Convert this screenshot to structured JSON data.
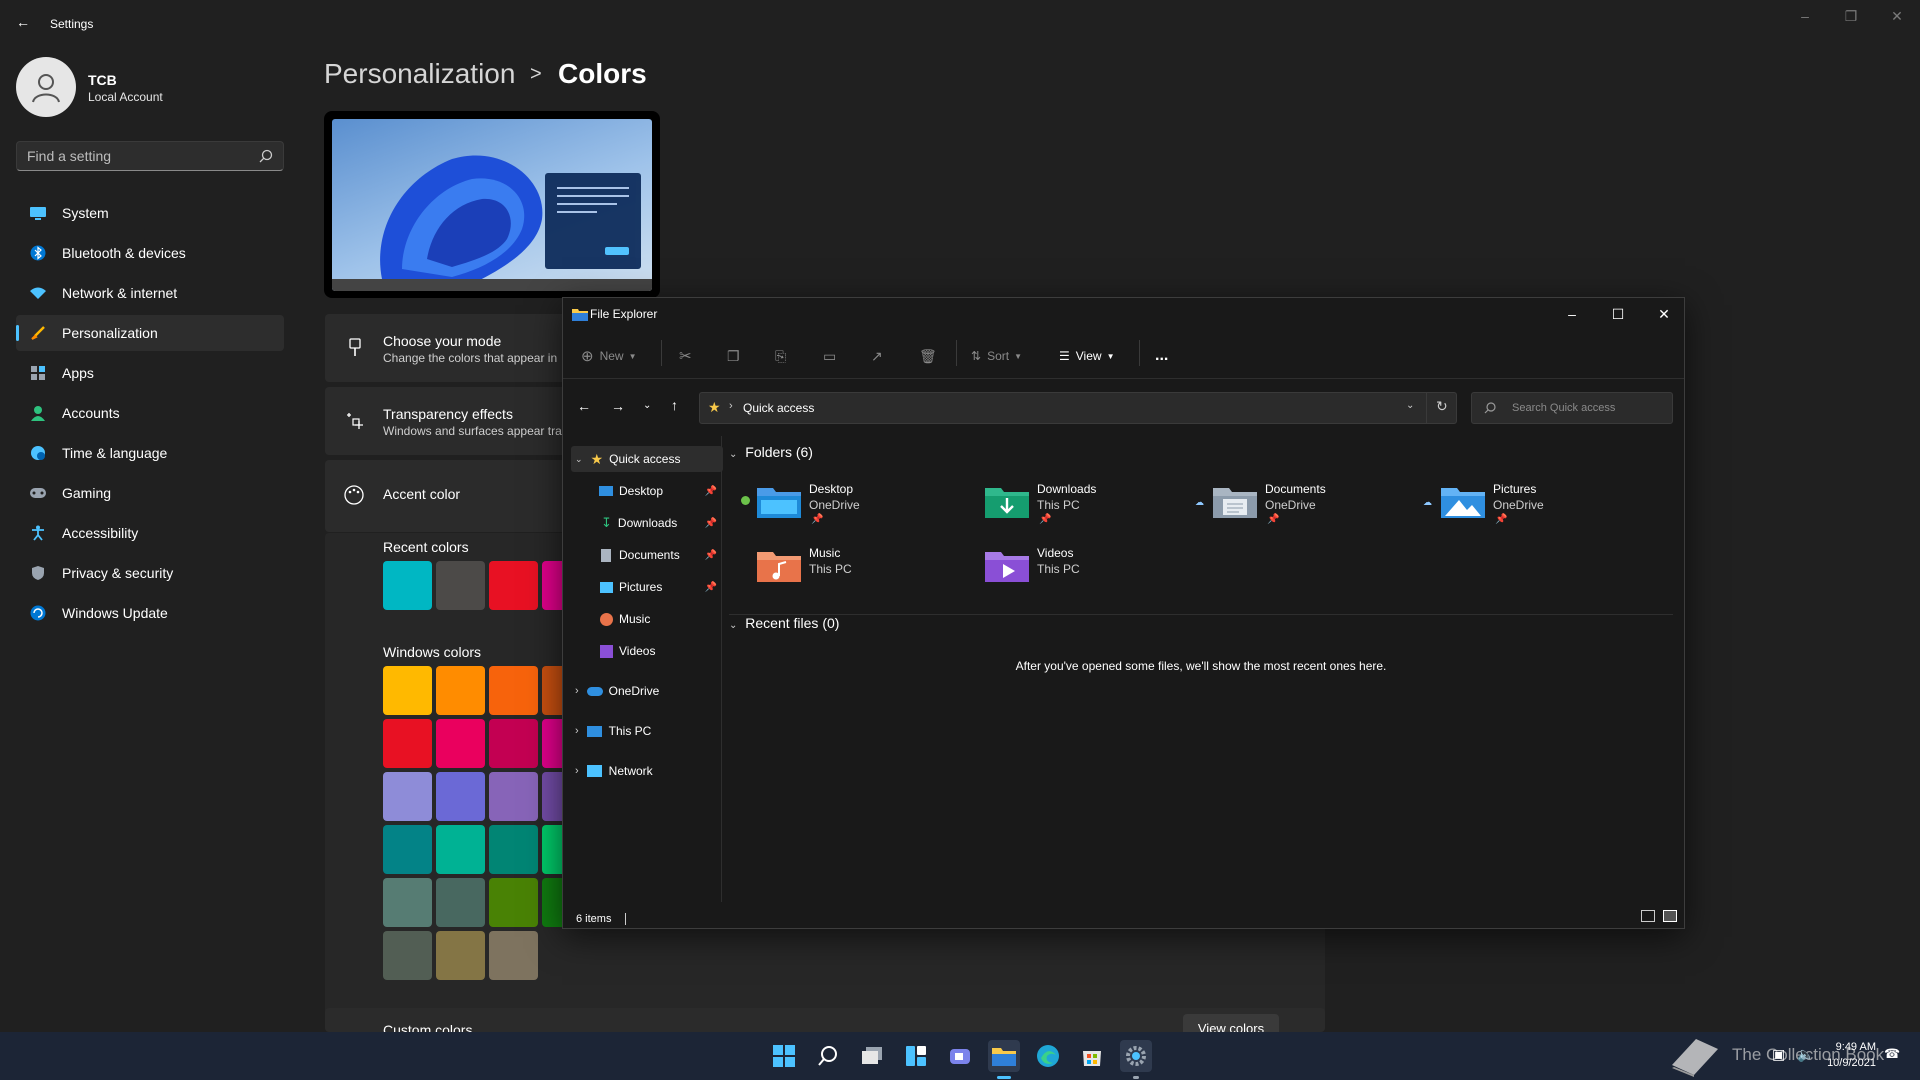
{
  "settings": {
    "window_title": "Settings",
    "user": {
      "name": "TCB",
      "account_type": "Local Account"
    },
    "search_placeholder": "Find a setting",
    "nav": [
      {
        "label": "System",
        "icon": "monitor-icon"
      },
      {
        "label": "Bluetooth & devices",
        "icon": "bluetooth-icon"
      },
      {
        "label": "Network & internet",
        "icon": "wifi-icon"
      },
      {
        "label": "Personalization",
        "icon": "brush-icon",
        "active": true
      },
      {
        "label": "Apps",
        "icon": "apps-icon"
      },
      {
        "label": "Accounts",
        "icon": "person-icon"
      },
      {
        "label": "Time & language",
        "icon": "globe-clock-icon"
      },
      {
        "label": "Gaming",
        "icon": "gamepad-icon"
      },
      {
        "label": "Accessibility",
        "icon": "accessibility-icon"
      },
      {
        "label": "Privacy & security",
        "icon": "shield-icon"
      },
      {
        "label": "Windows Update",
        "icon": "update-icon"
      }
    ],
    "breadcrumb": {
      "parent": "Personalization",
      "separator": ">",
      "current": "Colors"
    },
    "cards": {
      "mode": {
        "title": "Choose your mode",
        "subtitle": "Change the colors that appear in"
      },
      "transparency": {
        "title": "Transparency effects",
        "subtitle": "Windows and surfaces appear tra"
      },
      "accent": {
        "title": "Accent color"
      }
    },
    "recent_colors_label": "Recent colors",
    "recent_colors": [
      "#00b7c3",
      "#4c4a48",
      "#e81123",
      "#e3008c"
    ],
    "windows_colors_label": "Windows colors",
    "windows_colors": [
      [
        "#ffb900",
        "#ff8c00",
        "#f7630c",
        "#ca5010"
      ],
      [
        "#e81123",
        "#ea005e",
        "#c30052",
        "#e3008c"
      ],
      [
        "#8e8cd8",
        "#6b69d6",
        "#8764b8",
        "#744da9"
      ],
      [
        "#038387",
        "#00b294",
        "#018574",
        "#00cc6a"
      ],
      [
        "#567c73",
        "#486860",
        "#498205",
        "#107c10"
      ],
      [
        "#525e54",
        "#847545",
        "#7e735f"
      ]
    ],
    "custom_colors_label": "Custom colors",
    "view_colors_button": "View colors"
  },
  "explorer": {
    "title": "File Explorer",
    "toolbar": {
      "new": "New",
      "sort": "Sort",
      "view": "View",
      "more": "..."
    },
    "address": {
      "location": "Quick access",
      "search_placeholder": "Search Quick access"
    },
    "nav_tree": [
      {
        "label": "Quick access",
        "icon": "star-icon",
        "expanded": true,
        "selected": true
      },
      {
        "label": "Desktop",
        "icon": "desktop-icon",
        "pinned": true
      },
      {
        "label": "Downloads",
        "icon": "download-icon",
        "pinned": true
      },
      {
        "label": "Documents",
        "icon": "document-icon",
        "pinned": true
      },
      {
        "label": "Pictures",
        "icon": "picture-icon",
        "pinned": true
      },
      {
        "label": "Music",
        "icon": "music-icon"
      },
      {
        "label": "Videos",
        "icon": "video-icon"
      },
      {
        "label": "OneDrive",
        "icon": "cloud-icon"
      },
      {
        "label": "This PC",
        "icon": "pc-icon"
      },
      {
        "label": "Network",
        "icon": "network-icon"
      }
    ],
    "folders_header": "Folders (6)",
    "folders": [
      {
        "name": "Desktop",
        "location": "OneDrive",
        "pinned": true,
        "status": "synced",
        "color": "#1e90ff"
      },
      {
        "name": "Downloads",
        "location": "This PC",
        "pinned": true,
        "color": "#1aa37a"
      },
      {
        "name": "Documents",
        "location": "OneDrive",
        "pinned": true,
        "status": "cloud",
        "color": "#8c9bab"
      },
      {
        "name": "Pictures",
        "location": "OneDrive",
        "pinned": true,
        "status": "cloud",
        "color": "#2f8fe0"
      },
      {
        "name": "Music",
        "location": "This PC",
        "color": "#e8734a"
      },
      {
        "name": "Videos",
        "location": "This PC",
        "color": "#8a4fd6"
      }
    ],
    "recent_header": "Recent files (0)",
    "recent_empty": "After you've opened some files, we'll show the most recent ones here.",
    "status": "6 items"
  },
  "taskbar": {
    "icons": [
      "start-icon",
      "search-icon",
      "task-view-icon",
      "widgets-icon",
      "chat-icon",
      "file-explorer-icon",
      "edge-icon",
      "store-icon",
      "settings-icon"
    ],
    "time": "9:49 AM",
    "date": "10/9/2021",
    "watermark": "The Collection Book"
  }
}
